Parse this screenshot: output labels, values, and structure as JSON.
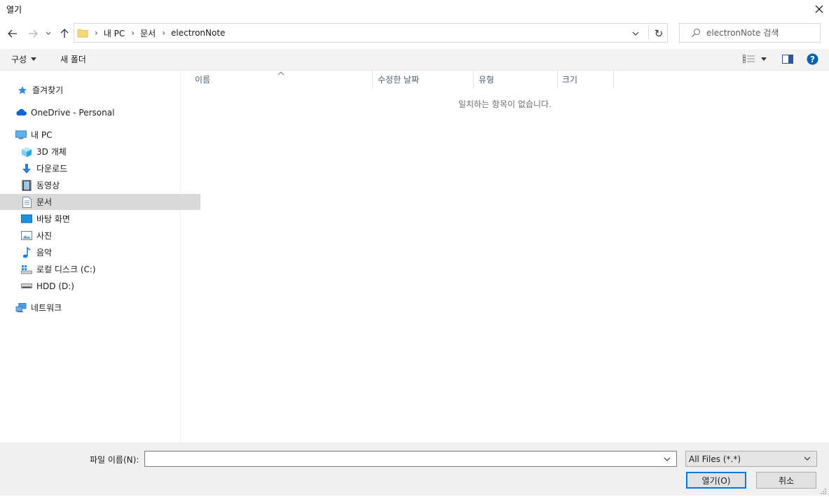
{
  "window": {
    "title": "열기"
  },
  "address": {
    "crumbs": [
      "내 PC",
      "문서",
      "electronNote"
    ]
  },
  "search": {
    "placeholder": "electronNote 검색"
  },
  "toolbar": {
    "organize": "구성",
    "new_folder": "새 폴더"
  },
  "sidebar": {
    "items": [
      {
        "label": "즐겨찾기",
        "icon": "star-icon"
      },
      {
        "label": "OneDrive - Personal",
        "icon": "cloud-icon"
      },
      {
        "label": "내 PC",
        "icon": "computer-icon"
      },
      {
        "label": "3D 개체",
        "icon": "cube-icon"
      },
      {
        "label": "다운로드",
        "icon": "download-icon"
      },
      {
        "label": "동영상",
        "icon": "video-icon"
      },
      {
        "label": "문서",
        "icon": "document-icon"
      },
      {
        "label": "바탕 화면",
        "icon": "desktop-icon"
      },
      {
        "label": "사진",
        "icon": "pictures-icon"
      },
      {
        "label": "음악",
        "icon": "music-icon"
      },
      {
        "label": "로컬 디스크 (C:)",
        "icon": "local-disk-icon"
      },
      {
        "label": "HDD (D:)",
        "icon": "hdd-icon"
      },
      {
        "label": "네트워크",
        "icon": "network-icon"
      }
    ],
    "selected": "문서"
  },
  "list": {
    "columns": [
      "이름",
      "수정한 날짜",
      "유형",
      "크기"
    ],
    "empty_message": "일치하는 항목이 없습니다."
  },
  "footer": {
    "filename_label": "파일 이름(N):",
    "filename_value": "",
    "filter_value": "All Files (*.*)",
    "open_label": "열기(O)",
    "cancel_label": "취소"
  },
  "colors": {
    "accent": "#0078d7",
    "selected_bg": "#d9d9d9",
    "folder": "#f8d775"
  }
}
